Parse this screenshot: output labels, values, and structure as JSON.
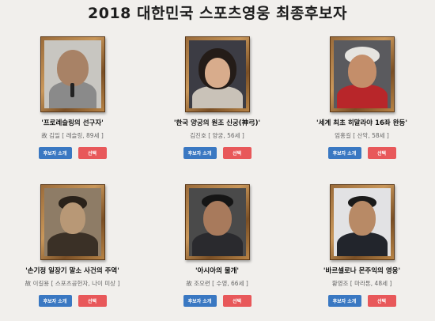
{
  "page": {
    "title": "2018 대한민국 스포츠영웅 최종후보자"
  },
  "buttons": {
    "intro_label": "후보자 소개",
    "select_label": "선택"
  },
  "candidates": [
    {
      "quote": "'프로레슬링의 선구자'",
      "info": "故 김일 [ 레슬링, 89세 ]"
    },
    {
      "quote": "'한국 양궁의 원조 신궁(神弓)'",
      "info": "김진호 [ 양궁, 56세 ]"
    },
    {
      "quote": "'세계 최초 히말라야 16좌 완등'",
      "info": "엄홍길 [ 산악, 58세 ]"
    },
    {
      "quote": "'손기정 일장기 말소 사건의 주역'",
      "info": "故 이길용 [ 스포츠공헌자, 나이 미상 ]"
    },
    {
      "quote": "'아시아의 물개'",
      "info": "故 조오련 [ 수영, 66세 ]"
    },
    {
      "quote": "'바르셀로나 몬주익의 영웅'",
      "info": "황영조 [ 마라톤, 48세 ]"
    }
  ]
}
